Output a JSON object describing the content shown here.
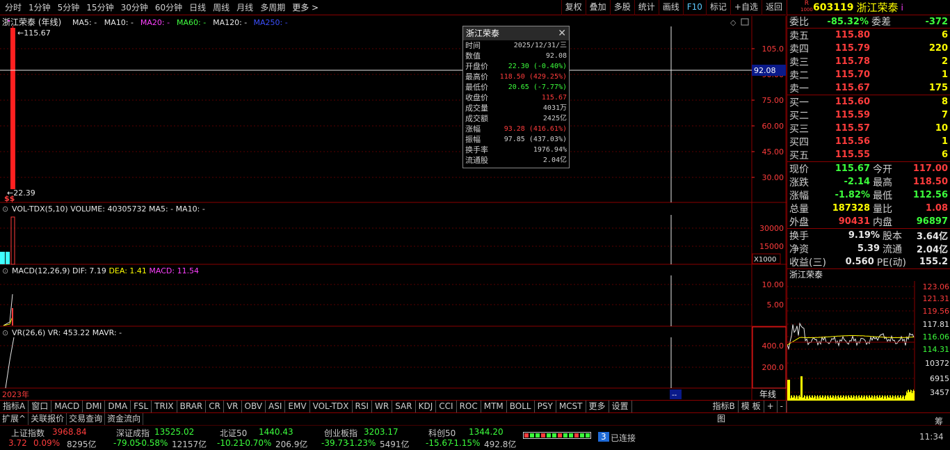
{
  "toolbar": {
    "periods": [
      "分时",
      "1分钟",
      "5分钟",
      "15分钟",
      "30分钟",
      "60分钟",
      "日线",
      "周线",
      "月线",
      "多周期",
      "更多 >"
    ],
    "tools": [
      "复权",
      "叠加",
      "多股",
      "统计",
      "画线",
      "F10",
      "标记",
      "+自选",
      "返回"
    ]
  },
  "chart": {
    "title": "浙江荣泰 (年线)",
    "ma": [
      {
        "label": "MA5: -",
        "color": "#e8e8e8"
      },
      {
        "label": "MA10: -",
        "color": "#e8e8e8"
      },
      {
        "label": "MA20: -",
        "color": "#ff40ff"
      },
      {
        "label": "MA60: -",
        "color": "#40ff40"
      },
      {
        "label": "MA120: -",
        "color": "#e8e8e8"
      },
      {
        "label": "MA250: -",
        "color": "#3c50ff"
      }
    ],
    "high_label": "115.67",
    "low_label": "22.39",
    "ss_mark": "$$",
    "y_ticks": [
      "105.0",
      "90.00",
      "75.00",
      "60.00",
      "45.00",
      "30.00"
    ],
    "cursor_value": "92.08",
    "vol_title": "VOL-TDX(5,10)",
    "vol_line": "VOLUME: 40305732",
    "vol_ma5": "MA5: -",
    "vol_ma10": "MA10: -",
    "vol_ticks": [
      "30000",
      "15000"
    ],
    "vol_unit": "X1000",
    "macd_title": "MACD(12,26,9)",
    "macd_dif": "DIF: 7.19",
    "macd_dea": "DEA: 1.41",
    "macd_val": "MACD: 11.54",
    "macd_ticks": [
      "10.00",
      "5.00"
    ],
    "vr_title": "VR(26,6)",
    "vr_val": "VR: 453.22",
    "vr_mavr": "MAVR: -",
    "vr_ticks": [
      "400.0",
      "200.0"
    ],
    "x_year": "2023年",
    "x_cursor": "--",
    "period_label": "年线"
  },
  "infobox": {
    "title": "浙江荣泰",
    "close_icon": "close-icon",
    "rows": [
      {
        "k": "时间",
        "v": "2025/12/31/三",
        "c": "#d0d0d0"
      },
      {
        "k": "数值",
        "v": "92.08",
        "c": "#d0d0d0"
      },
      {
        "k": "开盘价",
        "v": "22.30 (-0.40%)",
        "c": "#3cff3c"
      },
      {
        "k": "最高价",
        "v": "118.50 (429.25%)",
        "c": "#ff3c3c"
      },
      {
        "k": "最低价",
        "v": "20.65 (-7.77%)",
        "c": "#3cff3c"
      },
      {
        "k": "收盘价",
        "v": "115.67",
        "c": "#ff3c3c"
      },
      {
        "k": "成交量",
        "v": "4031万",
        "c": "#d0d0d0"
      },
      {
        "k": "成交额",
        "v": "2425亿",
        "c": "#d0d0d0"
      },
      {
        "k": "涨幅",
        "v": "93.28 (416.61%)",
        "c": "#ff3c3c"
      },
      {
        "k": "振幅",
        "v": "97.85 (437.03%)",
        "c": "#d0d0d0"
      },
      {
        "k": "换手率",
        "v": "1976.94%",
        "c": "#d0d0d0"
      },
      {
        "k": "流通股",
        "v": "2.04亿",
        "c": "#d0d0d0"
      }
    ]
  },
  "quote": {
    "badge": "R",
    "badge_sub": "1000",
    "code": "603119",
    "name": "浙江荣泰",
    "info_mark": "i",
    "weibi_label": "委比",
    "weibi": "-85.32%",
    "weicha_label": "委差",
    "weicha": "-372",
    "sell": [
      {
        "label": "卖五",
        "price": "115.80",
        "vol": "6"
      },
      {
        "label": "卖四",
        "price": "115.79",
        "vol": "220"
      },
      {
        "label": "卖三",
        "price": "115.78",
        "vol": "2"
      },
      {
        "label": "卖二",
        "price": "115.70",
        "vol": "1"
      },
      {
        "label": "卖一",
        "price": "115.67",
        "vol": "175"
      }
    ],
    "buy": [
      {
        "label": "买一",
        "price": "115.60",
        "vol": "8"
      },
      {
        "label": "买二",
        "price": "115.59",
        "vol": "7"
      },
      {
        "label": "买三",
        "price": "115.57",
        "vol": "10"
      },
      {
        "label": "买四",
        "price": "115.56",
        "vol": "1"
      },
      {
        "label": "买五",
        "price": "115.55",
        "vol": "6"
      }
    ],
    "stats": [
      {
        "l1": "现价",
        "v1": "115.67",
        "c1": "#3cff3c",
        "l2": "今开",
        "v2": "117.00",
        "c2": "#ff3c3c"
      },
      {
        "l1": "涨跌",
        "v1": "-2.14",
        "c1": "#3cff3c",
        "l2": "最高",
        "v2": "118.50",
        "c2": "#ff3c3c"
      },
      {
        "l1": "涨幅",
        "v1": "-1.82%",
        "c1": "#3cff3c",
        "l2": "最低",
        "v2": "112.56",
        "c2": "#3cff3c"
      },
      {
        "l1": "总量",
        "v1": "187328",
        "c1": "#ffff00",
        "l2": "量比",
        "v2": "1.08",
        "c2": "#ff3c3c"
      },
      {
        "l1": "外盘",
        "v1": "90431",
        "c1": "#ff3c3c",
        "l2": "内盘",
        "v2": "96897",
        "c2": "#3cff3c"
      }
    ],
    "stats2": [
      {
        "l1": "换手",
        "v1": "9.19%",
        "l2": "股本",
        "v2": "3.64亿"
      },
      {
        "l1": "净资",
        "v1": "5.39",
        "l2": "流通",
        "v2": "2.04亿"
      },
      {
        "l1": "收益(三)",
        "v1": "0.560",
        "l2": "PE(动)",
        "v2": "155.2"
      }
    ],
    "mini_title": "浙江荣泰",
    "mini_ticks": [
      "123.06",
      "121.31",
      "119.56",
      "117.81",
      "116.06",
      "114.31"
    ],
    "mini_ticks_colors": [
      "#ff3c3c",
      "#ff3c3c",
      "#ff3c3c",
      "#e8e8e8",
      "#3cff3c",
      "#3cff3c"
    ],
    "mini_vol_ticks": [
      "10372",
      "6915",
      "3457"
    ]
  },
  "indicator_tabs": [
    "指标A",
    "窗口",
    "MACD",
    "DMI",
    "DMA",
    "FSL",
    "TRIX",
    "BRAR",
    "CR",
    "VR",
    "OBV",
    "ASI",
    "EMV",
    "VOL-TDX",
    "RSI",
    "WR",
    "SAR",
    "KDJ",
    "CCI",
    "ROC",
    "MTM",
    "BOLL",
    "PSY",
    "MCST",
    "更多",
    "设置"
  ],
  "indicator_right": [
    "指标B",
    "模 板",
    "+",
    "-"
  ],
  "bottom_tabs": [
    "扩展^",
    "关联报价",
    "交易查询",
    "资金流向"
  ],
  "bottom_right_label": "图",
  "ticker": [
    {
      "name": "上证指数",
      "value": "3968.84",
      "chg": "3.72",
      "pct": "0.09%",
      "amt": "8295亿",
      "color": "#ff3c3c"
    },
    {
      "name": "深证成指",
      "value": "13525.02",
      "chg": "-79.05",
      "pct": "-0.58%",
      "amt": "12157亿",
      "color": "#3cff3c"
    },
    {
      "name": "北证50",
      "value": "1440.43",
      "chg": "-10.21",
      "pct": "-0.70%",
      "amt": "206.9亿",
      "color": "#3cff3c"
    },
    {
      "name": "创业板指",
      "value": "3203.17",
      "chg": "-39.73",
      "pct": "-1.23%",
      "amt": "5491亿",
      "color": "#3cff3c"
    },
    {
      "name": "科创50",
      "value": "1344.20",
      "chg": "-15.67",
      "pct": "-1.15%",
      "amt": "492.8亿",
      "color": "#3cff3c"
    }
  ],
  "connection": {
    "badge": "3",
    "text": "已连接"
  },
  "corner": {
    "top": "筹",
    "bottom": "11:34"
  }
}
